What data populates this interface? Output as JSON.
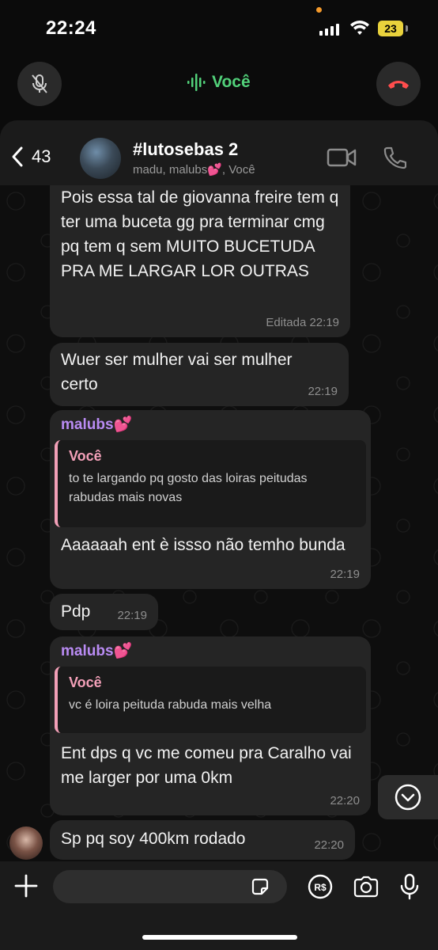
{
  "status": {
    "time": "22:24",
    "battery": "23"
  },
  "call": {
    "label": "Você"
  },
  "header": {
    "back_count": "43",
    "title": "#lutosebas 2",
    "subtitle": "madu, malubs💕, Você"
  },
  "messages": [
    {
      "text": "Pois essa tal de giovanna freire tem q ter uma buceta gg pra terminar cmg pq tem q sem MUITO BUCETUDA PRA ME LARGAR LOR OUTRAS",
      "time": "Editada 22:19"
    },
    {
      "text": "Wuer ser mulher vai ser mulher certo",
      "time": "22:19"
    },
    {
      "sender": "malubs💕",
      "quote_name": "Você",
      "quote_text": "to te largando pq gosto das loiras peitudas rabudas mais novas",
      "text": "Aaaaaah ent è issso não temho bunda",
      "time": "22:19"
    },
    {
      "text": "Pdp",
      "time": "22:19"
    },
    {
      "sender": "malubs💕",
      "quote_name": "Você",
      "quote_text": "vc é loira peituda rabuda mais velha",
      "text": "Ent dps q vc me comeu pra Caralho vai me larger por uma 0km",
      "time": "22:20"
    },
    {
      "text": "Sp pq soy 400km rodado",
      "time": "22:20"
    }
  ],
  "input": {
    "placeholder": ""
  }
}
